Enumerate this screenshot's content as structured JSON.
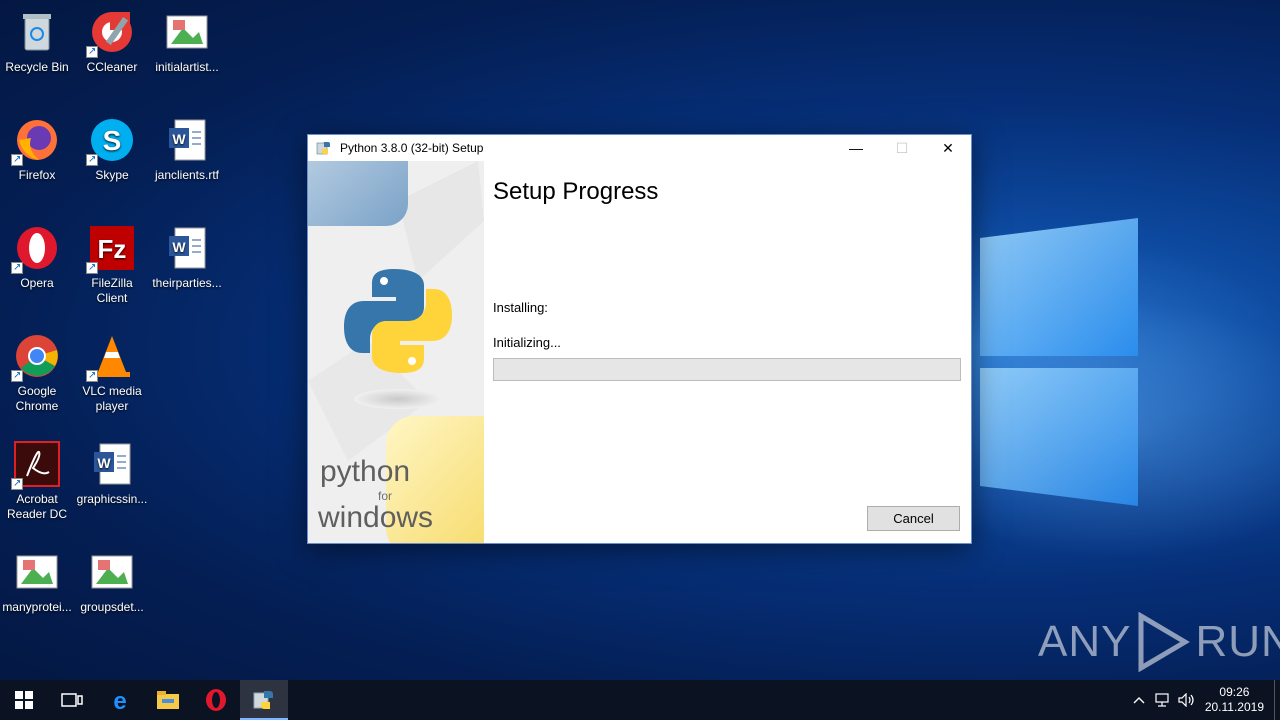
{
  "desktop": {
    "icons": [
      {
        "label": "Recycle Bin"
      },
      {
        "label": "CCleaner"
      },
      {
        "label": "initialartist..."
      },
      {
        "label": "Firefox"
      },
      {
        "label": "Skype"
      },
      {
        "label": "janclients.rtf"
      },
      {
        "label": "Opera"
      },
      {
        "label": "FileZilla Client"
      },
      {
        "label": "theirparties..."
      },
      {
        "label": "Google Chrome"
      },
      {
        "label": "VLC media player"
      },
      {
        "label": "Acrobat Reader DC"
      },
      {
        "label": "graphicssin..."
      },
      {
        "label": "manyprotei..."
      },
      {
        "label": "groupsdet..."
      }
    ]
  },
  "dialog": {
    "title": "Python 3.8.0 (32-bit) Setup",
    "minimize_glyph": "—",
    "maximize_glyph": "☐",
    "close_glyph": "✕",
    "heading": "Setup Progress",
    "installing_label": "Installing:",
    "status_text": "Initializing...",
    "progress_fraction": 0,
    "cancel_label": "Cancel",
    "side_brand_line1": "python",
    "side_brand_line2": "for",
    "side_brand_line3": "windows"
  },
  "watermark": {
    "left": "ANY",
    "right": "RUN"
  },
  "taskbar": {
    "items": [
      "start-icon",
      "task-view-icon",
      "edge-icon",
      "file-explorer-icon",
      "opera-icon",
      "python-setup-icon"
    ],
    "clock_time": "09:26",
    "clock_date": "20.11.2019"
  },
  "colors": {
    "accent": "#0078d7",
    "progress_fill": "#06b025"
  }
}
